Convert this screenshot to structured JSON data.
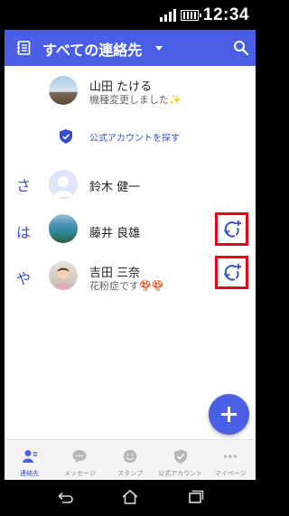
{
  "status_bar": {
    "time": "12:34"
  },
  "header": {
    "title": "すべての連絡先"
  },
  "top_contact": {
    "name": "山田 たける",
    "status": "機種変更しました✨"
  },
  "official_link": "公式アカウントを探す",
  "sections": [
    {
      "index": "さ",
      "name": "鈴木 健一",
      "status": ""
    },
    {
      "index": "は",
      "name": "藤井 良雄",
      "status": ""
    },
    {
      "index": "や",
      "name": "吉田 三奈",
      "status": "花粉症です🍄🍄"
    }
  ],
  "bottom_nav": [
    {
      "label": "連絡先",
      "icon": "contacts-icon",
      "active": true
    },
    {
      "label": "メッセージ",
      "icon": "message-icon",
      "active": false
    },
    {
      "label": "スタンプ",
      "icon": "sticker-icon",
      "active": false
    },
    {
      "label": "公式アカウント",
      "icon": "official-account-icon",
      "active": false
    },
    {
      "label": "マイページ",
      "icon": "more-icon",
      "active": false
    }
  ],
  "colors": {
    "primary": "#4a5fe6",
    "highlight_border": "#e8001c",
    "index_letter": "#3a4ec9"
  }
}
